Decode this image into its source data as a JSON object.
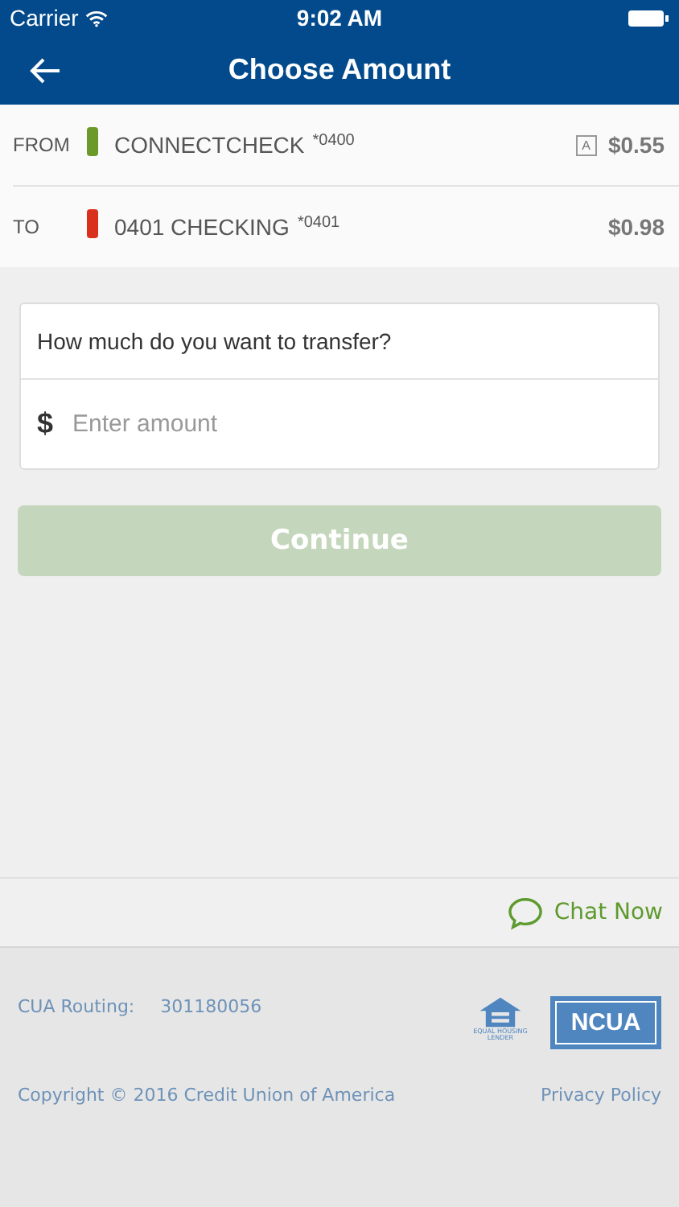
{
  "status_bar": {
    "carrier": "Carrier",
    "time": "9:02 AM"
  },
  "nav": {
    "title": "Choose Amount"
  },
  "accounts": [
    {
      "label": "FROM",
      "name": "CONNECTCHECK",
      "suffix": "*0400",
      "color": "#6b9a2a",
      "badge": "A",
      "balance": "$0.55"
    },
    {
      "label": "TO",
      "name": "0401 CHECKING",
      "suffix": "*0401",
      "color": "#d9301e",
      "balance": "$0.98"
    }
  ],
  "form": {
    "question": "How much do you want to transfer?",
    "currency": "$",
    "amount": {
      "placeholder": "Enter amount"
    }
  },
  "continue_button": {
    "label": "Continue",
    "disabled": true
  },
  "chat": {
    "label": "Chat Now"
  },
  "footer": {
    "routing_label": "CUA Routing:",
    "routing_number": "301180056",
    "housing_logo": "EQUAL HOUSING LENDER",
    "ncua_logo": "NCUA",
    "copyright": "Copyright © 2016 Credit Union of America",
    "privacy_link": "Privacy Policy"
  }
}
